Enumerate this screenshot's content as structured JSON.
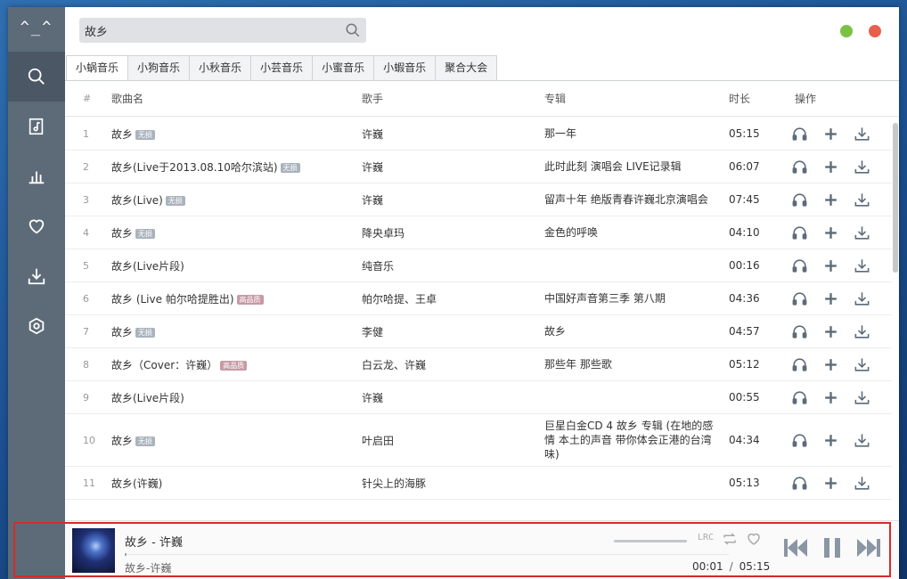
{
  "app": {
    "logo": "^_^"
  },
  "nav": [
    {
      "name": "nav-search",
      "icon": "search-icon"
    },
    {
      "name": "nav-playlist",
      "icon": "music-doc-icon"
    },
    {
      "name": "nav-charts",
      "icon": "bar-chart-icon"
    },
    {
      "name": "nav-favorites",
      "icon": "heart-icon"
    },
    {
      "name": "nav-downloads",
      "icon": "download-icon"
    },
    {
      "name": "nav-settings",
      "icon": "hex-gear-icon"
    }
  ],
  "search": {
    "value": "故乡",
    "icon": "search-icon"
  },
  "window_controls": {
    "minimize_color": "#7cc242",
    "close_color": "#e8604c"
  },
  "tabs": [
    {
      "label": "小蜗音乐",
      "active": true
    },
    {
      "label": "小狗音乐"
    },
    {
      "label": "小秋音乐"
    },
    {
      "label": "小芸音乐"
    },
    {
      "label": "小蜜音乐"
    },
    {
      "label": "小蝦音乐"
    },
    {
      "label": "聚合大会"
    }
  ],
  "table": {
    "headers": {
      "num": "#",
      "name": "歌曲名",
      "artist": "歌手",
      "album": "专辑",
      "duration": "时长",
      "ops": "操作"
    },
    "rows": [
      {
        "num": "1",
        "name": "故乡",
        "badge": "无损",
        "badge_type": "lossless",
        "artist": "许巍",
        "album": "那一年",
        "duration": "05:15"
      },
      {
        "num": "2",
        "name": "故乡(Live于2013.08.10哈尔滨站)",
        "badge": "无损",
        "badge_type": "lossless",
        "artist": "许巍",
        "album": "此时此刻 演唱会 LIVE记录辑",
        "duration": "06:07"
      },
      {
        "num": "3",
        "name": "故乡(Live)",
        "badge": "无损",
        "badge_type": "lossless",
        "artist": "许巍",
        "album": "留声十年 绝版青春许巍北京演唱会",
        "duration": "07:45"
      },
      {
        "num": "4",
        "name": "故乡",
        "badge": "无损",
        "badge_type": "lossless",
        "artist": "降央卓玛",
        "album": "金色的呼唤",
        "duration": "04:10"
      },
      {
        "num": "5",
        "name": "故乡(Live片段)",
        "badge": "",
        "badge_type": "",
        "artist": "纯音乐",
        "album": "",
        "duration": "00:16"
      },
      {
        "num": "6",
        "name": "故乡 (Live 帕尔哈提胜出)",
        "badge": "高品质",
        "badge_type": "hq",
        "artist": "帕尔哈提、王卓",
        "album": "中国好声音第三季 第八期",
        "duration": "04:36"
      },
      {
        "num": "7",
        "name": "故乡",
        "badge": "无损",
        "badge_type": "lossless",
        "artist": "李健",
        "album": "故乡",
        "duration": "04:57"
      },
      {
        "num": "8",
        "name": "故乡（Cover：许巍）",
        "badge": "高品质",
        "badge_type": "hq",
        "artist": "白云龙、许巍",
        "album": "那些年 那些歌",
        "duration": "05:12"
      },
      {
        "num": "9",
        "name": "故乡(Live片段)",
        "badge": "",
        "badge_type": "",
        "artist": "许巍",
        "album": "",
        "duration": "00:55"
      },
      {
        "num": "10",
        "name": "故乡",
        "badge": "无损",
        "badge_type": "lossless",
        "artist": "叶启田",
        "album": "巨星白金CD 4 故乡 专辑 (在地的感情 本土的声音 带你体会正港的台湾味)",
        "duration": "04:34",
        "tall": true
      },
      {
        "num": "11",
        "name": "故乡(许巍)",
        "badge": "",
        "badge_type": "",
        "artist": "针尖上的海豚",
        "album": "",
        "duration": "05:13"
      }
    ],
    "row_actions": [
      "headphones-icon",
      "add-icon",
      "download-icon"
    ]
  },
  "player": {
    "title": "故乡 - 许巍",
    "subtitle": "故乡-许巍",
    "current_time": "00:01",
    "separator": "/",
    "total_time": "05:15",
    "progress_fraction": 0.003,
    "lrc_label": "LRC",
    "highlight_color": "#d62a2a"
  }
}
